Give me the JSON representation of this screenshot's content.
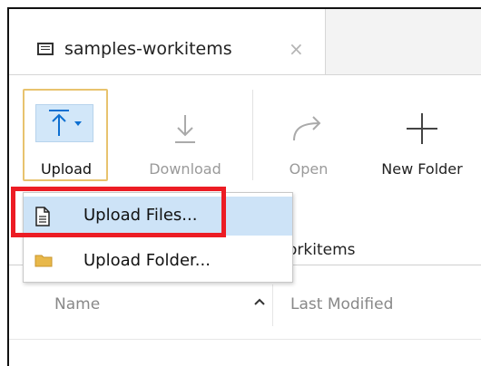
{
  "tab": {
    "title": "samples-workitems",
    "close_glyph": "×"
  },
  "toolbar": {
    "upload_label": "Upload",
    "download_label": "Download",
    "open_label": "Open",
    "new_folder_label": "New Folder"
  },
  "upload_menu": {
    "items": [
      {
        "label": "Upload Files...",
        "icon": "file-icon",
        "highlighted": true
      },
      {
        "label": "Upload Folder...",
        "icon": "folder-icon",
        "highlighted": false
      }
    ]
  },
  "path": {
    "text": "orkitems"
  },
  "columns": {
    "name": "Name",
    "last_modified": "Last Modified"
  },
  "colors": {
    "accent_highlight": "#cde3f7",
    "upload_border": "#e8c36e",
    "upload_icon": "#0d6fd1",
    "annotation_red": "#ec1c24",
    "folder_icon": "#e8b84a"
  }
}
